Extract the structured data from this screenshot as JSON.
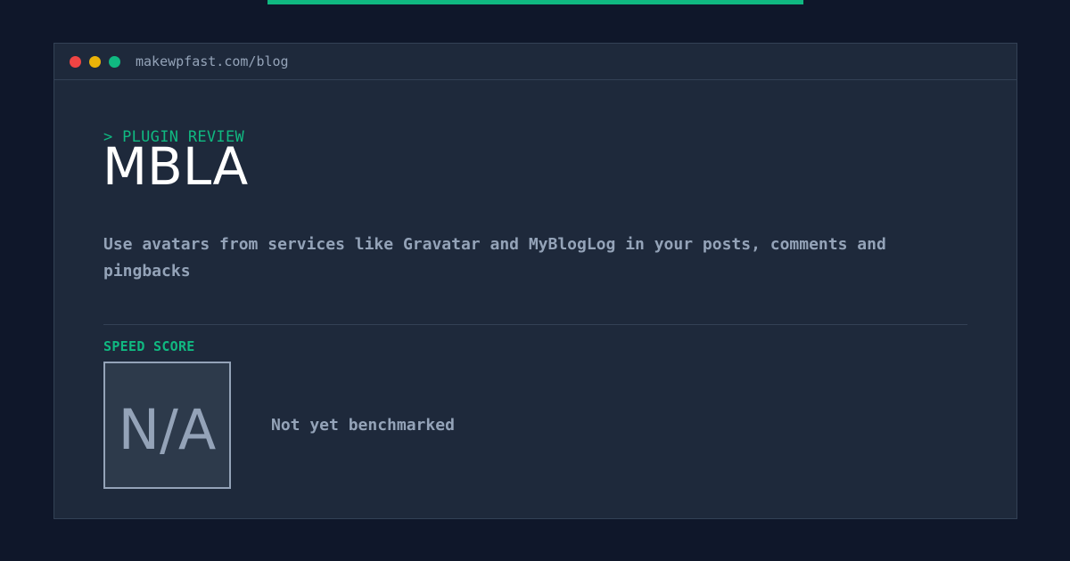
{
  "colors": {
    "background": "#0f172a",
    "panel": "#1e293b",
    "accent": "#10b981",
    "muted_text": "#94a3b8",
    "heading_text": "#ffffff",
    "window_close": "#ef4444",
    "window_minimize": "#eab308",
    "window_maximize": "#10b981"
  },
  "browser": {
    "url": "makewpfast.com/blog"
  },
  "article": {
    "eyebrow": "> PLUGIN REVIEW",
    "title": "MBLA",
    "description": "Use avatars from services like Gravatar and MyBlogLog in your posts, comments and pingbacks"
  },
  "speed": {
    "label": "SPEED SCORE",
    "value": "N/A",
    "note": "Not yet benchmarked"
  }
}
